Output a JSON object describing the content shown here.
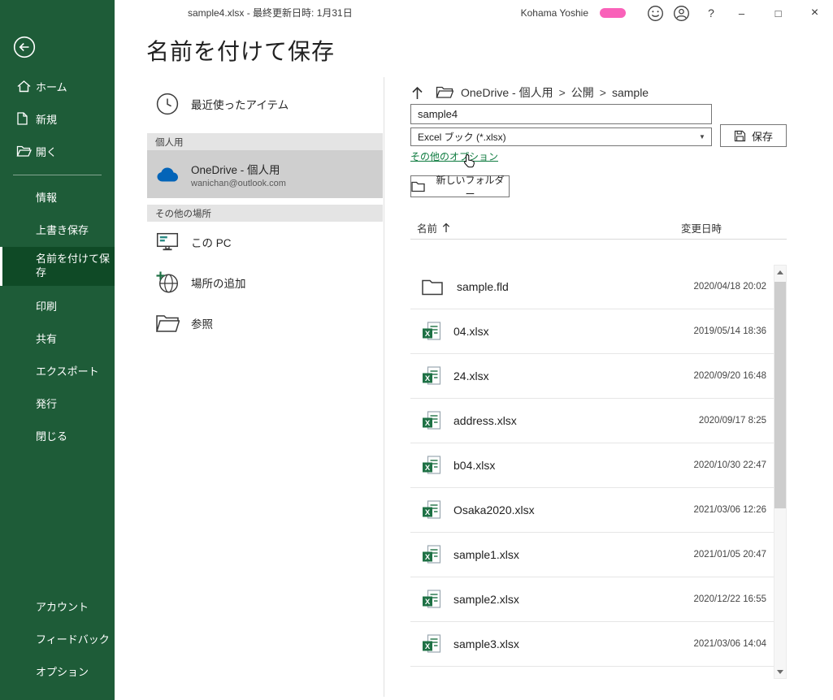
{
  "theme": {
    "sidebar_green": "#1e5c38",
    "sidebar_selected": "#0f4a26",
    "accent_green": "#107c41",
    "excel_green": "#1e7145",
    "onedrive_blue": "#0364b8",
    "selected_place_gray": "#cfcfcf",
    "section_header_gray": "#e4e4e4"
  },
  "titlebar": {
    "document_title": "sample4.xlsx - 最終更新日時: 1月31日",
    "user_name": "Kohama Yoshie",
    "help_glyph": "?",
    "minimize_glyph": "–",
    "maximize_glyph": "□",
    "close_glyph": "×"
  },
  "sidebar": {
    "top_items": [
      "ホーム",
      "新規",
      "開く"
    ],
    "main_items": [
      "情報",
      "上書き保存",
      "名前を付けて保存",
      "印刷",
      "共有",
      "エクスポート",
      "発行",
      "閉じる"
    ],
    "bottom_items": [
      "アカウント",
      "フィードバック",
      "オプション"
    ]
  },
  "page": {
    "title": "名前を付けて保存"
  },
  "places": {
    "recent_label": "最近使ったアイテム",
    "personal_header": "個人用",
    "onedrive": {
      "label": "OneDrive - 個人用",
      "email": "wanichan@outlook.com"
    },
    "other_header": "その他の場所",
    "this_pc": "この PC",
    "add_place": "場所の追加",
    "browse": "参照"
  },
  "save_panel": {
    "breadcrumb": {
      "parts": [
        "OneDrive - 個人用",
        "公開",
        "sample"
      ],
      "separator": ">"
    },
    "filename": "sample4",
    "filetype": "Excel ブック (*.xlsx)",
    "dropdown_caret": "▼",
    "save_label": "保存",
    "more_options_label": "その他のオプション",
    "new_folder_label": "新しいフォルダー",
    "name_column": "名前",
    "modified_column": "変更日時",
    "files": [
      {
        "name": "sample.fld",
        "type": "folder",
        "modified": "2020/04/18 20:02"
      },
      {
        "name": "04.xlsx",
        "type": "excel",
        "modified": "2019/05/14 18:36"
      },
      {
        "name": "24.xlsx",
        "type": "excel",
        "modified": "2020/09/20 16:48"
      },
      {
        "name": "address.xlsx",
        "type": "excel",
        "modified": "2020/09/17 8:25"
      },
      {
        "name": "b04.xlsx",
        "type": "excel",
        "modified": "2020/10/30 22:47"
      },
      {
        "name": "Osaka2020.xlsx",
        "type": "excel",
        "modified": "2021/03/06 12:26"
      },
      {
        "name": "sample1.xlsx",
        "type": "excel",
        "modified": "2021/01/05 20:47"
      },
      {
        "name": "sample2.xlsx",
        "type": "excel",
        "modified": "2020/12/22 16:55"
      },
      {
        "name": "sample3.xlsx",
        "type": "excel",
        "modified": "2021/03/06 14:04"
      }
    ]
  }
}
